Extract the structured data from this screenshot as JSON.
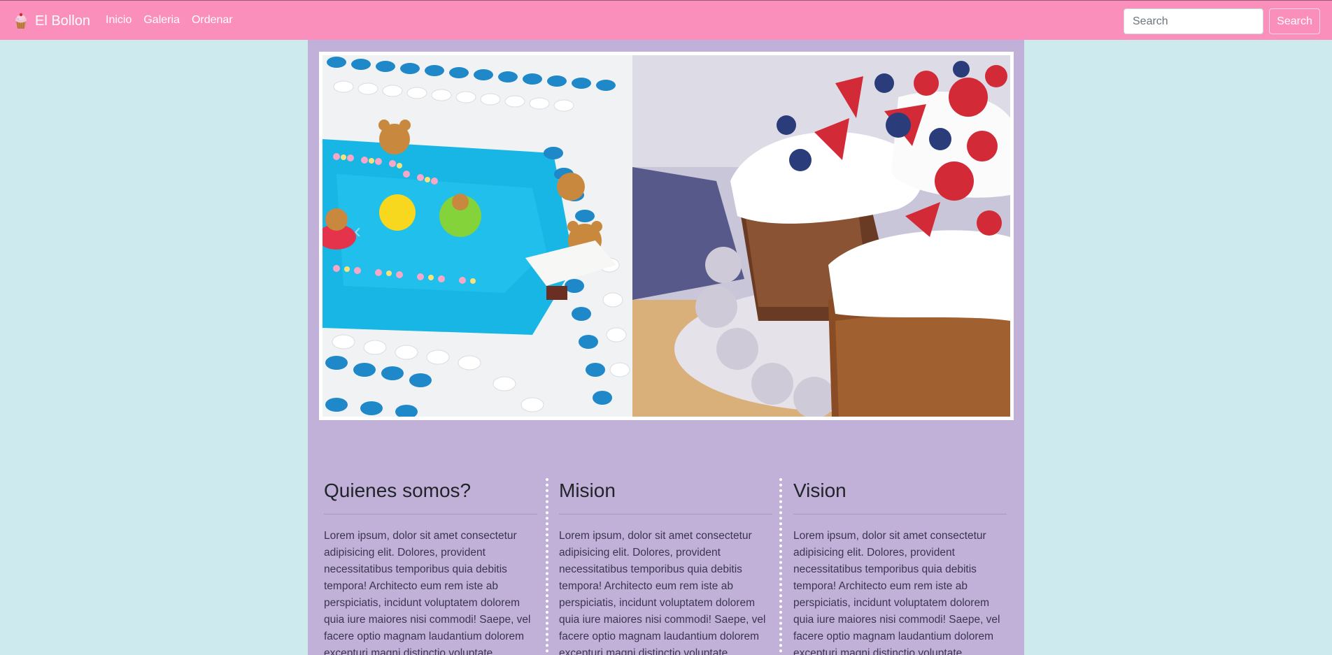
{
  "navbar": {
    "brand": "El Bollon",
    "links": [
      "Inicio",
      "Galeria",
      "Ordenar"
    ],
    "search_placeholder": "Search",
    "search_button": "Search"
  },
  "sections": [
    {
      "title": "Quienes somos?",
      "text": "Lorem ipsum, dolor sit amet consectetur adipisicing elit. Dolores, provident necessitatibus temporibus quia debitis tempora! Architecto eum rem iste ab perspiciatis, incidunt voluptatem dolorem quia iure maiores nisi commodi! Saepe, vel facere optio magnam laudantium dolorem excepturi magni distinctio voluptate."
    },
    {
      "title": "Mision",
      "text": "Lorem ipsum, dolor sit amet consectetur adipisicing elit. Dolores, provident necessitatibus temporibus quia debitis tempora! Architecto eum rem iste ab perspiciatis, incidunt voluptatem dolorem quia iure maiores nisi commodi! Saepe, vel facere optio magnam laudantium dolorem excepturi magni distinctio voluptate."
    },
    {
      "title": "Vision",
      "text": "Lorem ipsum, dolor sit amet consectetur adipisicing elit. Dolores, provident necessitatibus temporibus quia debitis tempora! Architecto eum rem iste ab perspiciatis, incidunt voluptatem dolorem quia iure maiores nisi commodi! Saepe, vel facere optio magnam laudantium dolorem excepturi magni distinctio voluptate."
    }
  ],
  "colors": {
    "navbar": "#fb8fbb",
    "page_bg": "#cdebee",
    "container_bg": "#c1b1d8"
  },
  "icons": {
    "brand": "cupcake-icon",
    "carousel_prev": "chevron-left-icon"
  }
}
